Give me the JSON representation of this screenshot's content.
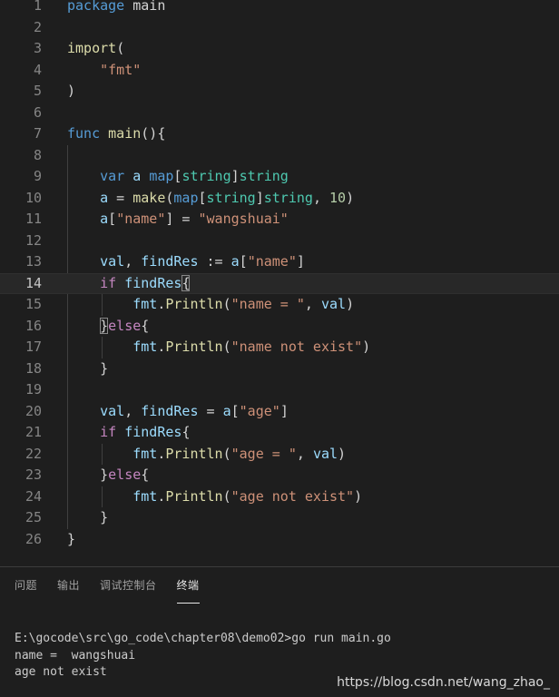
{
  "editor": {
    "lines": [
      {
        "n": "1",
        "tokens": [
          [
            "kw",
            "package"
          ],
          [
            "plain",
            " main"
          ]
        ]
      },
      {
        "n": "2",
        "tokens": []
      },
      {
        "n": "3",
        "tokens": [
          [
            "fn",
            "import"
          ],
          [
            "plain",
            "("
          ]
        ]
      },
      {
        "n": "4",
        "tokens": [
          [
            "plain",
            "    "
          ],
          [
            "str",
            "\"fmt\""
          ]
        ]
      },
      {
        "n": "5",
        "tokens": [
          [
            "plain",
            ")"
          ]
        ]
      },
      {
        "n": "6",
        "tokens": []
      },
      {
        "n": "7",
        "tokens": [
          [
            "kw",
            "func"
          ],
          [
            "plain",
            " "
          ],
          [
            "fn",
            "main"
          ],
          [
            "plain",
            "(){"
          ]
        ]
      },
      {
        "n": "8",
        "tokens": []
      },
      {
        "n": "9",
        "tokens": [
          [
            "plain",
            "    "
          ],
          [
            "kw",
            "var"
          ],
          [
            "plain",
            " "
          ],
          [
            "var",
            "a"
          ],
          [
            "plain",
            " "
          ],
          [
            "kw",
            "map"
          ],
          [
            "plain",
            "["
          ],
          [
            "type",
            "string"
          ],
          [
            "plain",
            "]"
          ],
          [
            "type",
            "string"
          ]
        ]
      },
      {
        "n": "10",
        "tokens": [
          [
            "plain",
            "    "
          ],
          [
            "var",
            "a"
          ],
          [
            "plain",
            " = "
          ],
          [
            "fn",
            "make"
          ],
          [
            "plain",
            "("
          ],
          [
            "kw",
            "map"
          ],
          [
            "plain",
            "["
          ],
          [
            "type",
            "string"
          ],
          [
            "plain",
            "]"
          ],
          [
            "type",
            "string"
          ],
          [
            "plain",
            ", "
          ],
          [
            "num",
            "10"
          ],
          [
            "plain",
            ")"
          ]
        ]
      },
      {
        "n": "11",
        "tokens": [
          [
            "plain",
            "    "
          ],
          [
            "var",
            "a"
          ],
          [
            "plain",
            "["
          ],
          [
            "str",
            "\"name\""
          ],
          [
            "plain",
            "] = "
          ],
          [
            "str",
            "\"wangshuai\""
          ]
        ]
      },
      {
        "n": "12",
        "tokens": []
      },
      {
        "n": "13",
        "tokens": [
          [
            "plain",
            "    "
          ],
          [
            "var",
            "val"
          ],
          [
            "plain",
            ", "
          ],
          [
            "var",
            "findRes"
          ],
          [
            "plain",
            " := "
          ],
          [
            "var",
            "a"
          ],
          [
            "plain",
            "["
          ],
          [
            "str",
            "\"name\""
          ],
          [
            "plain",
            "]"
          ]
        ]
      },
      {
        "n": "14",
        "active": true,
        "tokens": [
          [
            "plain",
            "    "
          ],
          [
            "kw2",
            "if"
          ],
          [
            "plain",
            " "
          ],
          [
            "var",
            "findRes"
          ],
          [
            "bracket",
            "{"
          ]
        ]
      },
      {
        "n": "15",
        "tokens": [
          [
            "plain",
            "        "
          ],
          [
            "var",
            "fmt"
          ],
          [
            "plain",
            "."
          ],
          [
            "fn",
            "Println"
          ],
          [
            "plain",
            "("
          ],
          [
            "str",
            "\"name = \""
          ],
          [
            "plain",
            ", "
          ],
          [
            "var",
            "val"
          ],
          [
            "plain",
            ")"
          ]
        ]
      },
      {
        "n": "16",
        "tokens": [
          [
            "plain",
            "    "
          ],
          [
            "bracket",
            "}"
          ],
          [
            "kw2",
            "else"
          ],
          [
            "plain",
            "{"
          ]
        ]
      },
      {
        "n": "17",
        "tokens": [
          [
            "plain",
            "        "
          ],
          [
            "var",
            "fmt"
          ],
          [
            "plain",
            "."
          ],
          [
            "fn",
            "Println"
          ],
          [
            "plain",
            "("
          ],
          [
            "str",
            "\"name not exist\""
          ],
          [
            "plain",
            ")"
          ]
        ]
      },
      {
        "n": "18",
        "tokens": [
          [
            "plain",
            "    }"
          ]
        ]
      },
      {
        "n": "19",
        "tokens": []
      },
      {
        "n": "20",
        "tokens": [
          [
            "plain",
            "    "
          ],
          [
            "var",
            "val"
          ],
          [
            "plain",
            ", "
          ],
          [
            "var",
            "findRes"
          ],
          [
            "plain",
            " = "
          ],
          [
            "var",
            "a"
          ],
          [
            "plain",
            "["
          ],
          [
            "str",
            "\"age\""
          ],
          [
            "plain",
            "]"
          ]
        ]
      },
      {
        "n": "21",
        "tokens": [
          [
            "plain",
            "    "
          ],
          [
            "kw2",
            "if"
          ],
          [
            "plain",
            " "
          ],
          [
            "var",
            "findRes"
          ],
          [
            "plain",
            "{"
          ]
        ]
      },
      {
        "n": "22",
        "tokens": [
          [
            "plain",
            "        "
          ],
          [
            "var",
            "fmt"
          ],
          [
            "plain",
            "."
          ],
          [
            "fn",
            "Println"
          ],
          [
            "plain",
            "("
          ],
          [
            "str",
            "\"age = \""
          ],
          [
            "plain",
            ", "
          ],
          [
            "var",
            "val"
          ],
          [
            "plain",
            ")"
          ]
        ]
      },
      {
        "n": "23",
        "tokens": [
          [
            "plain",
            "    }"
          ],
          [
            "kw2",
            "else"
          ],
          [
            "plain",
            "{"
          ]
        ]
      },
      {
        "n": "24",
        "tokens": [
          [
            "plain",
            "        "
          ],
          [
            "var",
            "fmt"
          ],
          [
            "plain",
            "."
          ],
          [
            "fn",
            "Println"
          ],
          [
            "plain",
            "("
          ],
          [
            "str",
            "\"age not exist\""
          ],
          [
            "plain",
            ")"
          ]
        ]
      },
      {
        "n": "25",
        "tokens": [
          [
            "plain",
            "    }"
          ]
        ]
      },
      {
        "n": "26",
        "tokens": [
          [
            "plain",
            "}"
          ]
        ]
      }
    ]
  },
  "panel": {
    "tabs": [
      {
        "label": "问题",
        "name": "tab-problems"
      },
      {
        "label": "输出",
        "name": "tab-output"
      },
      {
        "label": "调试控制台",
        "name": "tab-debug-console"
      },
      {
        "label": "终端",
        "name": "tab-terminal",
        "active": true
      }
    ],
    "terminal_lines": [
      "E:\\gocode\\src\\go_code\\chapter08\\demo02>go run main.go",
      "name =  wangshuai",
      "age not exist"
    ]
  },
  "watermark": "https://blog.csdn.net/wang_zhao_",
  "colors": {
    "background": "#1e1e1e",
    "keyword": "#569cd6",
    "control_keyword": "#c586c0",
    "type": "#4ec9b0",
    "string": "#ce9178",
    "number": "#b5cea8",
    "function": "#dcdcaa",
    "variable": "#9cdcfe"
  }
}
